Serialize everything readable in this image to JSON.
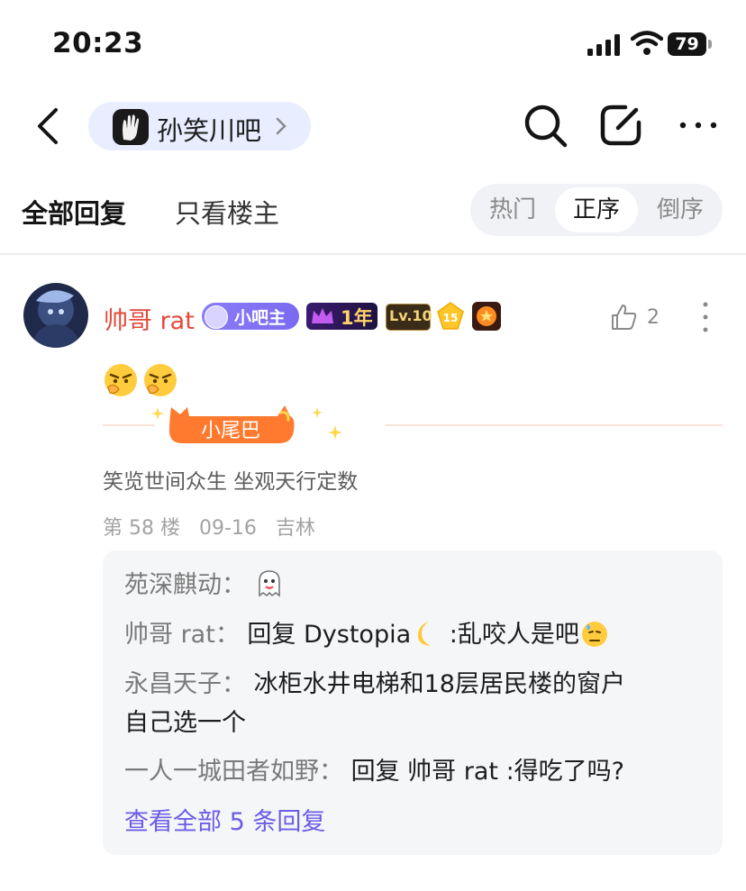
{
  "status_bar": {
    "time": "20:23",
    "battery": "79"
  },
  "nav": {
    "forum_name": "孙笑川吧"
  },
  "tabs": {
    "all_replies": "全部回复",
    "owner_only": "只看楼主"
  },
  "sort": {
    "hot": "热门",
    "asc": "正序",
    "desc": "倒序",
    "selected": "正序"
  },
  "post": {
    "username": "帅哥 rat",
    "badges": {
      "moderator": "小吧主",
      "years": "1年",
      "level": "Lv.10",
      "rank": "15"
    },
    "likes": "2",
    "tail_label": "小尾巴",
    "signature": "笑览世间众生 坐观天行定数",
    "floor": "第 58 楼",
    "date": "09-16",
    "location": "吉林"
  },
  "replies": [
    {
      "name": "苑深麒动：",
      "text": ""
    },
    {
      "name": "帅哥 rat：",
      "text_a": "回复 Dystopia",
      "text_b": " :乱咬人是吧"
    },
    {
      "name": "永昌天子：",
      "text": "冰柜水井电梯和18层居民楼的窗户",
      "text_2": "自己选一个"
    },
    {
      "name": "一人一城田者如野：",
      "text": "回复 帅哥 rat :得吃了吗?"
    }
  ],
  "view_all": "查看全部 5 条回复",
  "colors": {
    "accent": "#6c5ce7",
    "username": "#e4493a",
    "chip": "#e8eeff"
  }
}
